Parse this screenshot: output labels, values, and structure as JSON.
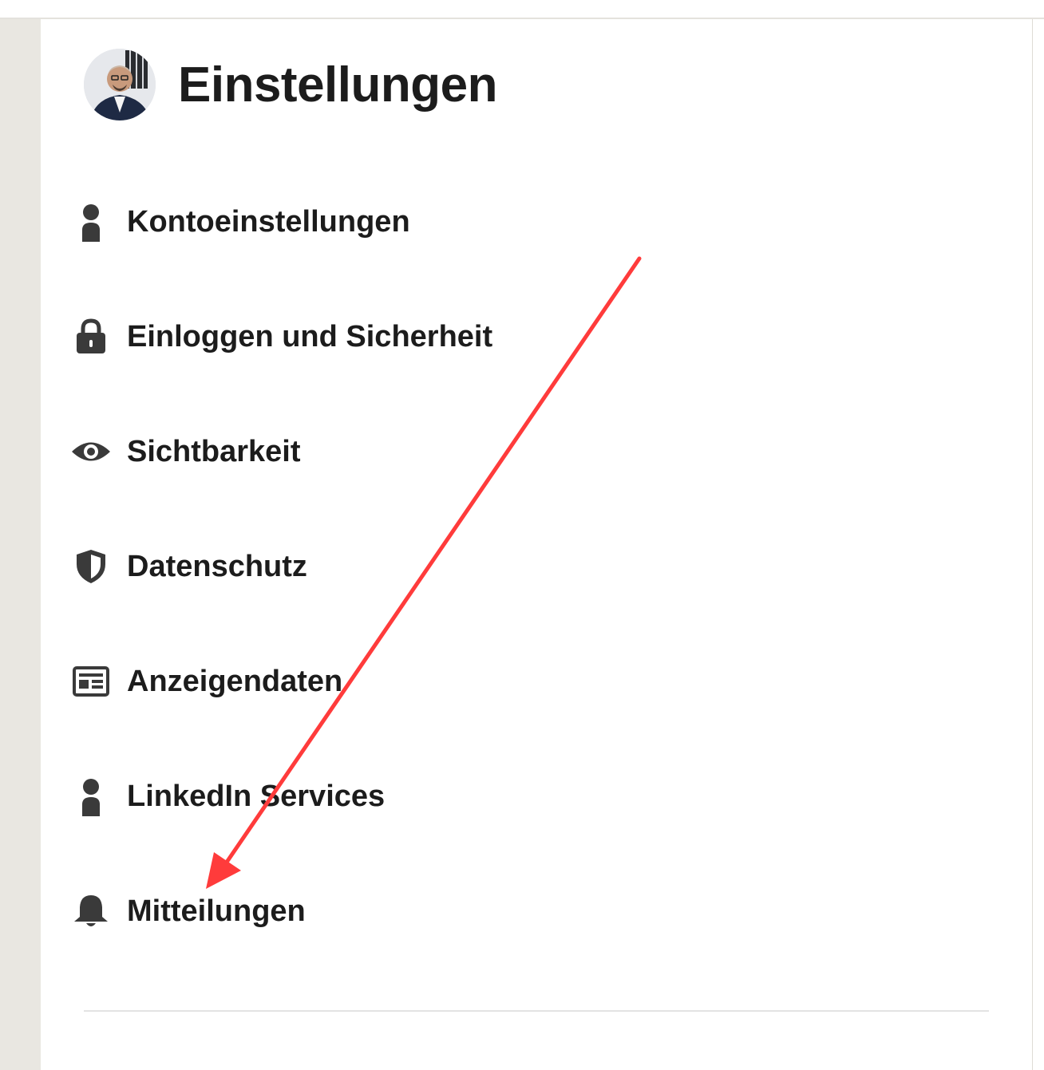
{
  "header": {
    "title": "Einstellungen",
    "avatar": "user-profile-photo"
  },
  "menu": {
    "items": [
      {
        "label": "Kontoeinstellungen",
        "icon": "person-icon"
      },
      {
        "label": "Einloggen und Sicherheit",
        "icon": "lock-icon"
      },
      {
        "label": "Sichtbarkeit",
        "icon": "eye-icon"
      },
      {
        "label": "Datenschutz",
        "icon": "shield-icon"
      },
      {
        "label": "Anzeigendaten",
        "icon": "newspaper-icon"
      },
      {
        "label": "LinkedIn Services",
        "icon": "person-icon"
      },
      {
        "label": "Mitteilungen",
        "icon": "bell-icon"
      }
    ]
  },
  "annotation": {
    "type": "arrow",
    "color": "#ff3b3b",
    "target": "Mitteilungen"
  },
  "colors": {
    "background": "#e9e7e1",
    "card": "#ffffff",
    "text": "#1c1c1c",
    "icon": "#3a3a3a",
    "arrow": "#ff3b3b"
  }
}
